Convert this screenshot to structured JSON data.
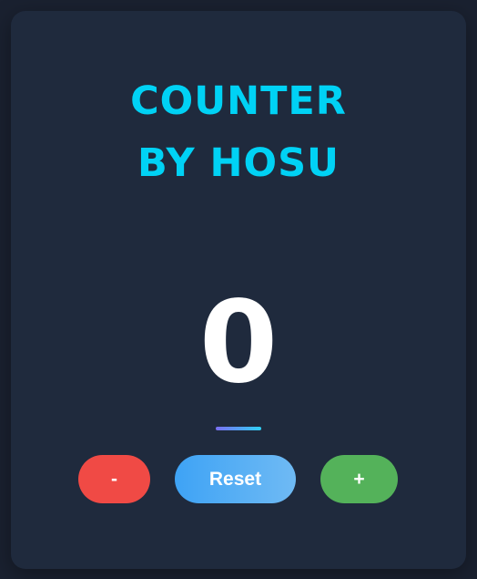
{
  "app": {
    "title_line1": "COUNTER",
    "title_line2": "BY HOSU"
  },
  "counter": {
    "value": "0"
  },
  "buttons": {
    "decrement_label": "-",
    "reset_label": "Reset",
    "increment_label": "+"
  },
  "colors": {
    "background": "#1a2130",
    "card": "#1f2a3d",
    "title": "#00d2f5",
    "decrement": "#f04a45",
    "reset": "#4aa8f5",
    "increment": "#54b25a"
  }
}
